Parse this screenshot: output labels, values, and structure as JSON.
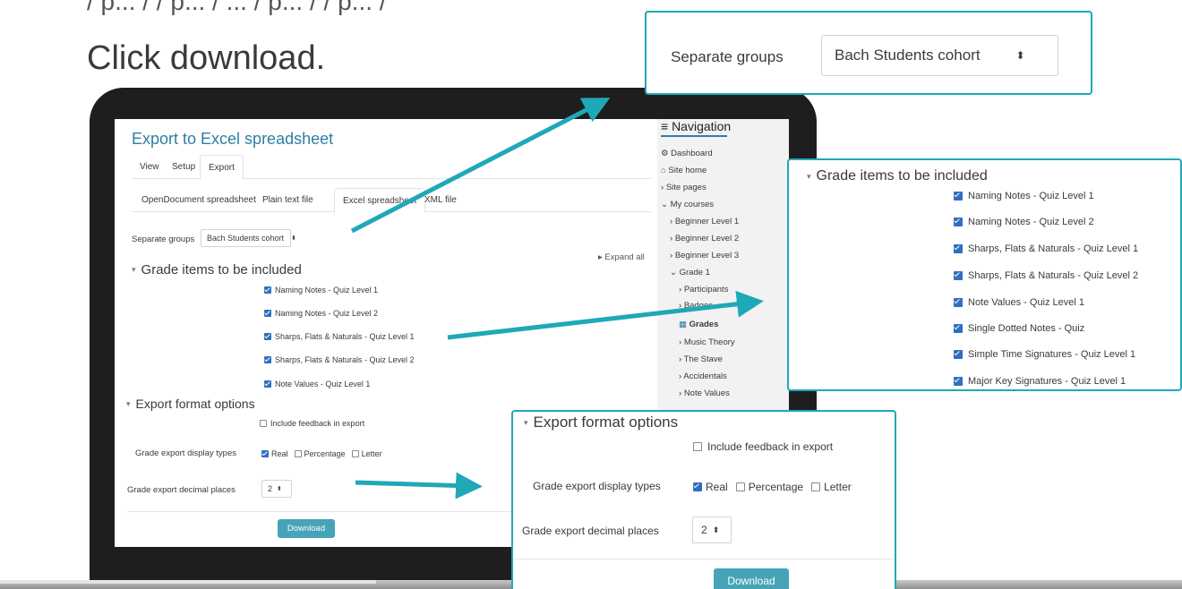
{
  "instruction": "Click download.",
  "page": {
    "title": "Export to Excel spreadsheet",
    "tabs": [
      "View",
      "Setup",
      "Export"
    ],
    "subtabs": [
      "OpenDocument spreadsheet",
      "Plain text file",
      "Excel spreadsheet",
      "XML file"
    ],
    "separate_groups_label": "Separate groups",
    "separate_groups_value": "Bach Students cohort",
    "expand_all": "Expand all",
    "grade_items_heading": "Grade items to be included",
    "grade_items": [
      "Naming Notes - Quiz Level 1",
      "Naming Notes - Quiz Level 2",
      "Sharps, Flats & Naturals - Quiz Level 1",
      "Sharps, Flats & Naturals - Quiz Level 2",
      "Note Values - Quiz Level 1",
      "Single Dotted Notes - Quiz",
      "Simple Time Signatures - Quiz Level 1",
      "Major Key Signatures - Quiz Level 1"
    ],
    "export_format_heading": "Export format options",
    "include_feedback": "Include feedback in export",
    "display_types_label": "Grade export display types",
    "display_types": [
      "Real",
      "Percentage",
      "Letter"
    ],
    "decimal_places_label": "Grade export decimal places",
    "decimal_places_value": "2",
    "download_label": "Download"
  },
  "navigation": {
    "title": "Navigation",
    "items": [
      "Dashboard",
      "Site home",
      "Site pages",
      "My courses",
      "Beginner Level 1",
      "Beginner Level 2",
      "Beginner Level 3",
      "Grade 1",
      "Participants",
      "Badges",
      "Grades",
      "Music Theory",
      "The Stave",
      "Accidentals",
      "Note Values"
    ]
  },
  "colors": {
    "accent": "#1fa8b8",
    "link": "#2f7ea3",
    "checkbox": "#2f6fc0",
    "button": "#46a3b8"
  }
}
